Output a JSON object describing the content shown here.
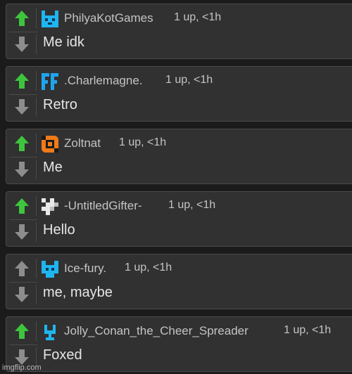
{
  "colors": {
    "upvote_active": "#3ec53e",
    "vote_inactive": "#8d8d8d",
    "panel_bg": "#313131",
    "text": "#e6e6e6",
    "meta_text": "#c4c4c4"
  },
  "comments": [
    {
      "username": "PhilyaKotGames",
      "meta": "1 up, <1h",
      "text": "Me idk",
      "upvoted": true,
      "avatar_icon": "blue-cat-pixel-icon"
    },
    {
      "username": ".Charlemagne.",
      "meta": "1 up, <1h",
      "text": "Retro",
      "upvoted": true,
      "avatar_icon": "blue-ff-pixel-icon"
    },
    {
      "username": "Zoltnat",
      "meta": "1 up, <1h",
      "text": "Me",
      "upvoted": true,
      "avatar_icon": "orange-pixel-icon"
    },
    {
      "username": "-UntitledGifter-",
      "meta": "1 up, <1h",
      "text": "Hello",
      "upvoted": true,
      "avatar_icon": "white-pixel-icon"
    },
    {
      "username": "Ice-fury.",
      "meta": "1 up, <1h",
      "text": "me, maybe",
      "upvoted": false,
      "avatar_icon": "blue-fox-pixel-icon"
    },
    {
      "username": "Jolly_Conan_the_Cheer_Spreader",
      "meta": "1 up, <1h",
      "text": "Foxed",
      "upvoted": true,
      "avatar_icon": "blue-y-pixel-icon"
    }
  ],
  "watermark": "imgflip.com"
}
